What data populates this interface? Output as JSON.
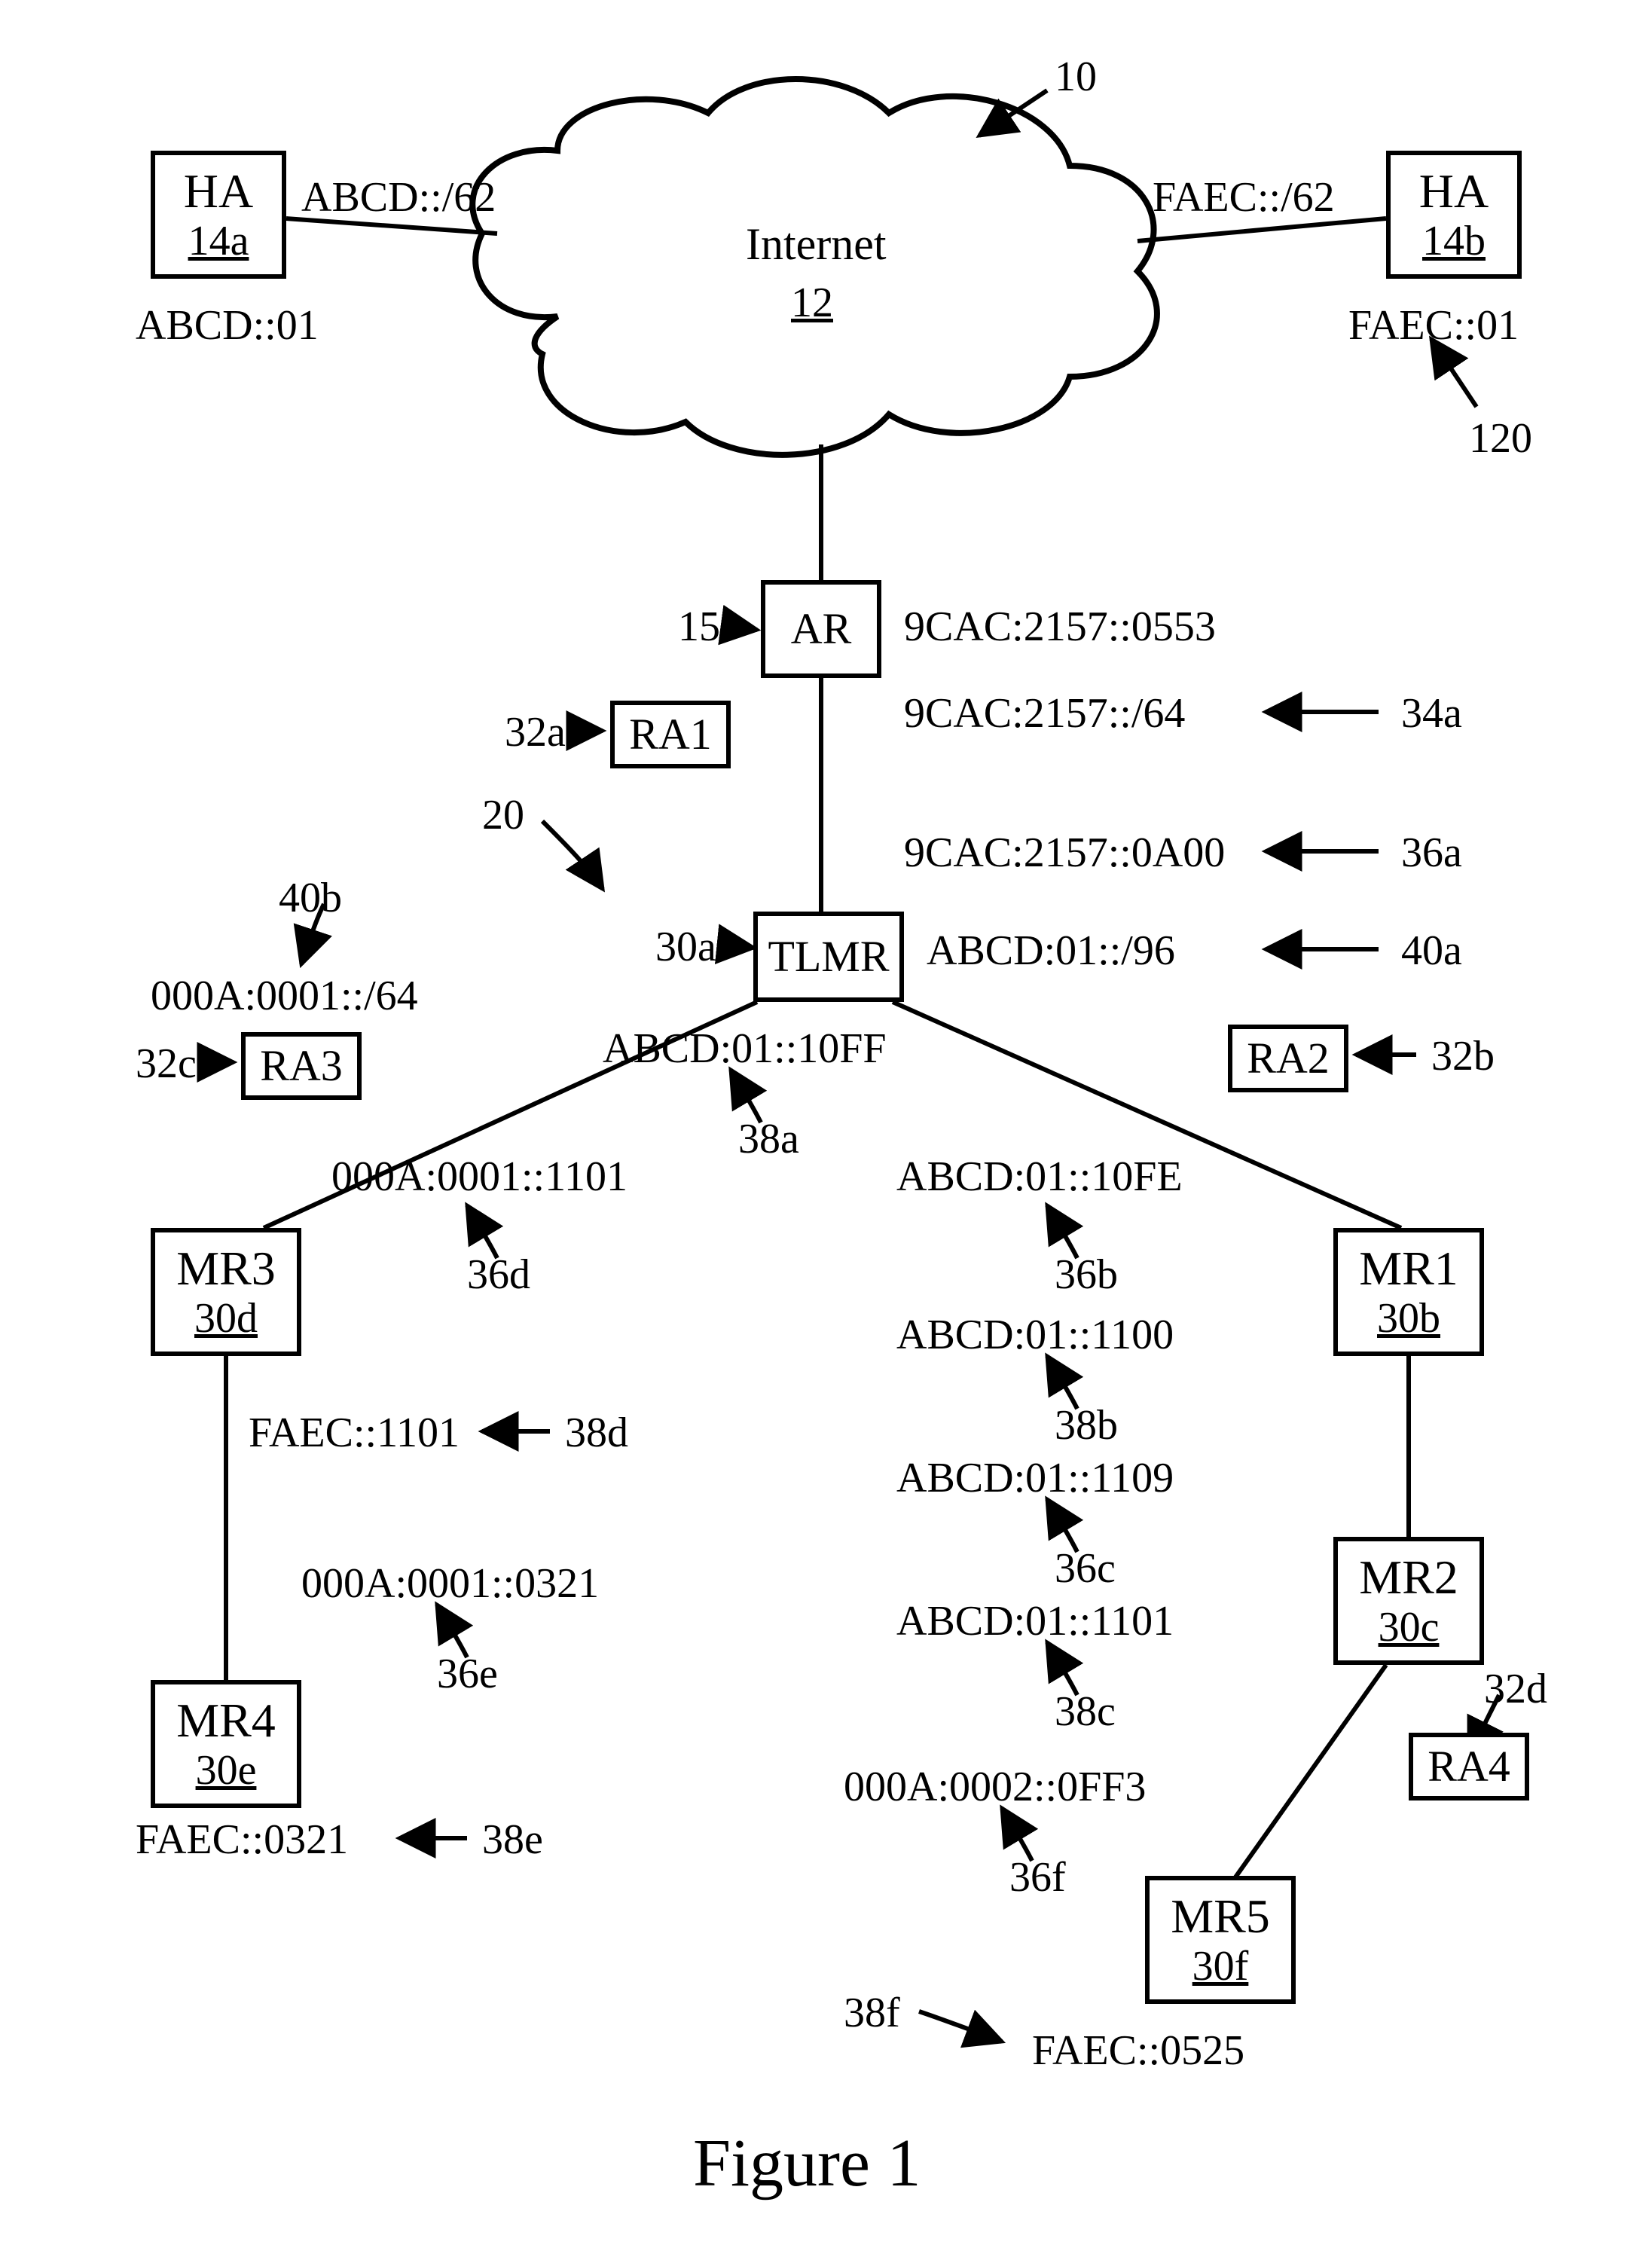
{
  "figure_title": "Figure 1",
  "refs": {
    "r10": "10",
    "r12_label": "Internet",
    "r12_sub": "12",
    "r15": "15",
    "r20": "20",
    "r120": "120"
  },
  "nodes": {
    "HA_a": {
      "title": "HA",
      "sub": "14a",
      "addr": "ABCD::01",
      "link_label": "ABCD::/62"
    },
    "HA_b": {
      "title": "HA",
      "sub": "14b",
      "addr": "FAEC::01",
      "link_label": "FAEC::/62"
    },
    "AR": {
      "title": "AR",
      "addr": "9CAC:2157::0553"
    },
    "TLMR": {
      "title": "TLMR"
    },
    "MR1": {
      "title": "MR1",
      "sub": "30b"
    },
    "MR2": {
      "title": "MR2",
      "sub": "30c"
    },
    "MR3": {
      "title": "MR3",
      "sub": "30d"
    },
    "MR4": {
      "title": "MR4",
      "sub": "30e"
    },
    "MR5": {
      "title": "MR5",
      "sub": "30f"
    },
    "RA1": {
      "title": "RA1",
      "ref": "32a"
    },
    "RA2": {
      "title": "RA2",
      "ref": "32b"
    },
    "RA3": {
      "title": "RA3",
      "ref": "32c"
    },
    "RA4": {
      "title": "RA4",
      "ref": "32d"
    }
  },
  "addrs": {
    "a30a": "30a",
    "a34a": {
      "text": "9CAC:2157::/64",
      "ref": "34a"
    },
    "a36a": {
      "text": "9CAC:2157::0A00",
      "ref": "36a"
    },
    "a36b": {
      "text": "ABCD:01::10FE",
      "ref": "36b"
    },
    "a36c": {
      "text": "ABCD:01::1109",
      "ref": "36c"
    },
    "a36d": {
      "text": "000A:0001::1101",
      "ref": "36d"
    },
    "a36e": {
      "text": "000A:0001::0321",
      "ref": "36e"
    },
    "a36f": {
      "text": "000A:0002::0FF3",
      "ref": "36f"
    },
    "a38a": {
      "text": "ABCD:01::10FF",
      "ref": "38a"
    },
    "a38b": {
      "text": "ABCD:01::1100",
      "ref": "38b"
    },
    "a38c": {
      "text": "ABCD:01::1101",
      "ref": "38c"
    },
    "a38d": {
      "text": "FAEC::1101",
      "ref": "38d"
    },
    "a38e": {
      "text": "FAEC::0321",
      "ref": "38e"
    },
    "a38f": {
      "text": "FAEC::0525",
      "ref": "38f"
    },
    "a40a": {
      "text": "ABCD:01::/96",
      "ref": "40a"
    },
    "a40b": {
      "text": "000A:0001::/64",
      "ref": "40b"
    }
  }
}
